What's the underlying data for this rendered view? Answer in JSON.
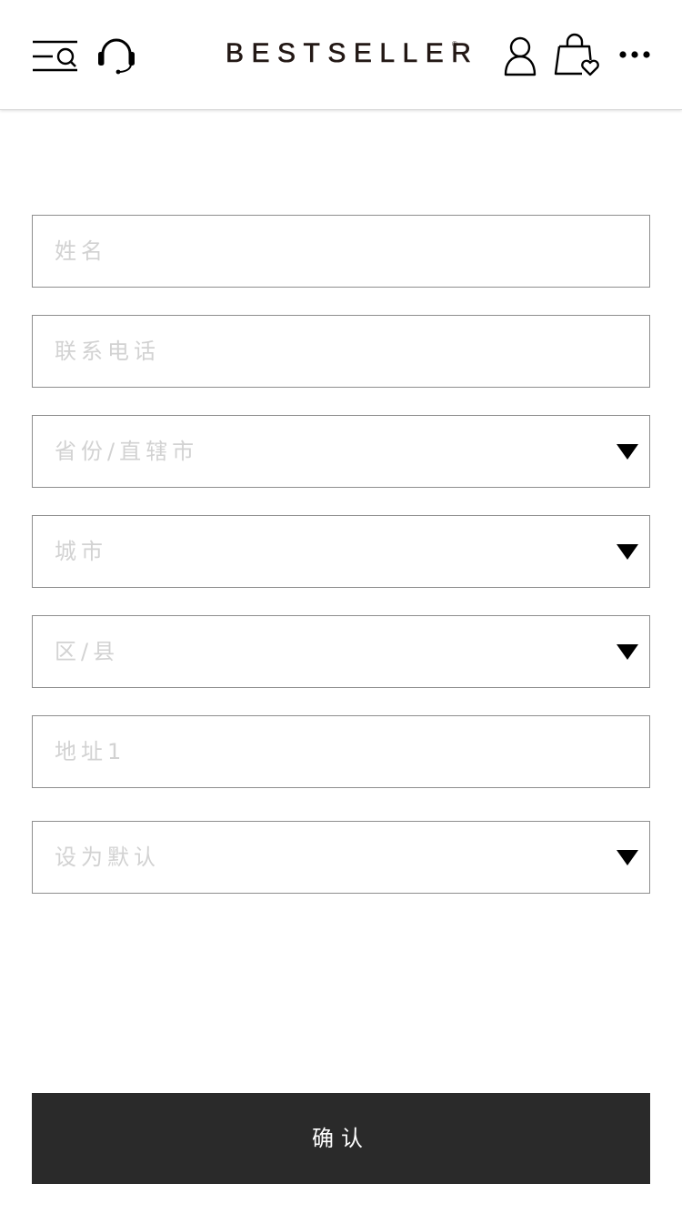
{
  "header": {
    "brand": "BESTSELLER",
    "brand_mark": "®",
    "icons": [
      "menu-search-icon",
      "customer-service-headset-icon",
      "user-icon",
      "shopping-bag-heart-icon",
      "more-icon"
    ]
  },
  "form": {
    "name_placeholder": "姓名",
    "phone_placeholder": "联系电话",
    "province_placeholder": "省份/直辖市",
    "city_placeholder": "城市",
    "district_placeholder": "区/县",
    "address1_placeholder": "地址1",
    "default_placeholder": "设为默认"
  },
  "confirm_label": "确认",
  "colors": {
    "button_bg": "#2a2a2a",
    "border": "#8e8e8e",
    "placeholder": "#d2d2d2"
  }
}
